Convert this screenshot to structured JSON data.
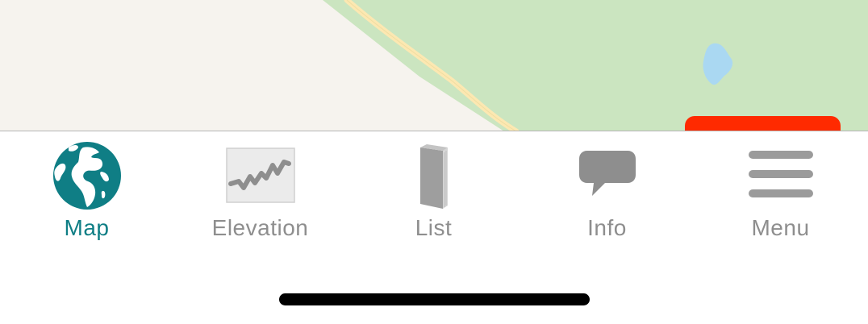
{
  "colors": {
    "map_background": "#f6f3ee",
    "park_green": "#cbe5c0",
    "water_blue": "#aad8f2",
    "road_yellow": "#fce8b2",
    "cta_red": "#ff2a00",
    "active_tab": "#0f7e85",
    "inactive_tab": "#8e8e8e",
    "home_indicator": "#000000"
  },
  "map": {
    "features": [
      "park-area",
      "road",
      "water-pond",
      "action-button"
    ]
  },
  "tabbar": {
    "active_tab": "map",
    "tabs": [
      {
        "id": "map",
        "label": "Map",
        "icon": "globe-icon"
      },
      {
        "id": "elevation",
        "label": "Elevation",
        "icon": "elevation-chart-icon"
      },
      {
        "id": "list",
        "label": "List",
        "icon": "book-icon"
      },
      {
        "id": "info",
        "label": "Info",
        "icon": "speech-bubble-icon"
      },
      {
        "id": "menu",
        "label": "Menu",
        "icon": "hamburger-menu-icon"
      }
    ]
  }
}
